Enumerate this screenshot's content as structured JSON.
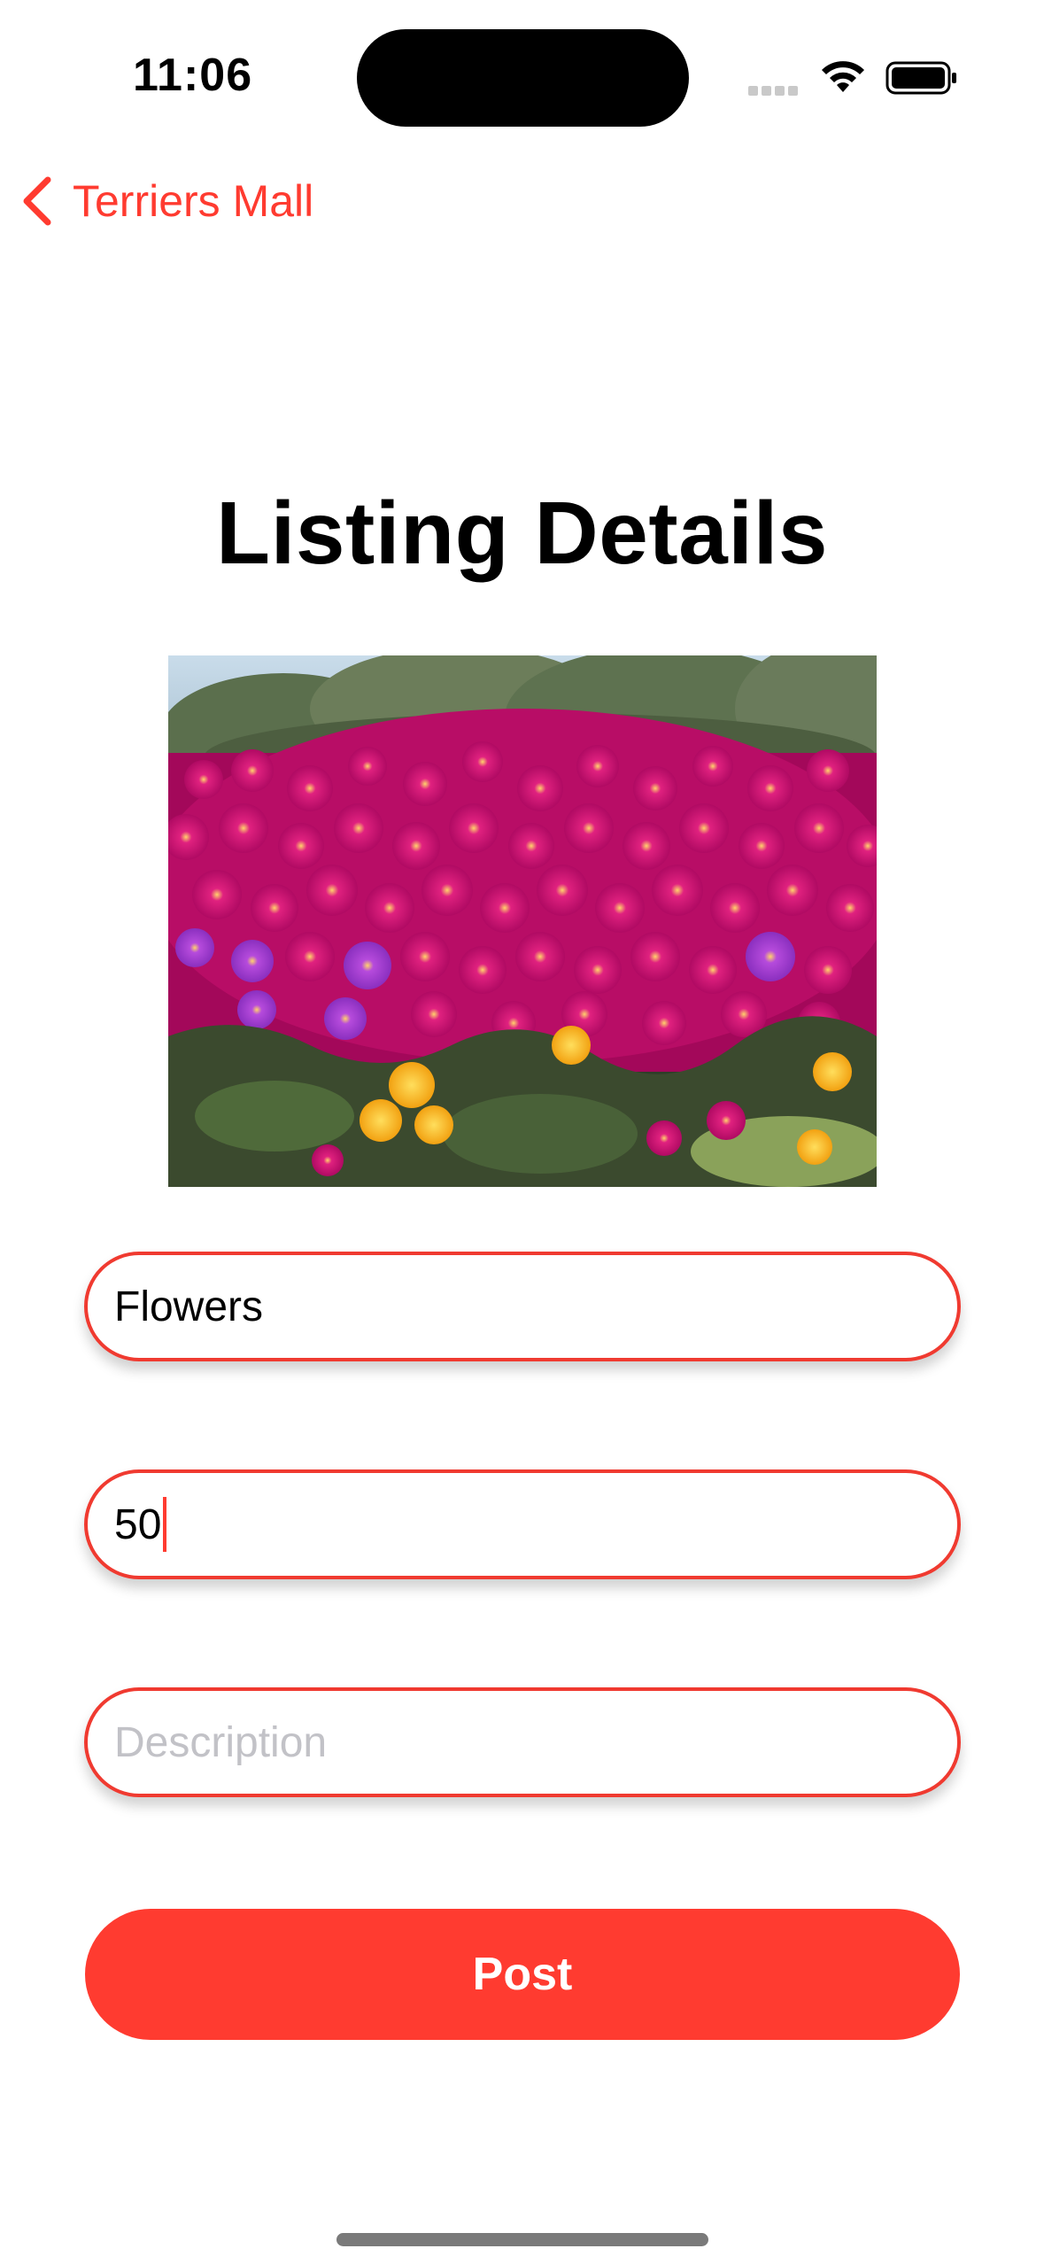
{
  "status_bar": {
    "time": "11:06"
  },
  "nav": {
    "back_label": "Terriers Mall"
  },
  "page": {
    "title": "Listing Details"
  },
  "form": {
    "name_value": "Flowers",
    "price_value": "50",
    "description_placeholder": "Description",
    "post_label": "Post"
  },
  "colors": {
    "accent": "#ff3b30",
    "field_border": "#f03a30",
    "placeholder": "#c2c2c7"
  },
  "icons": [
    "cellular-signal-icon",
    "wifi-icon",
    "battery-icon",
    "chevron-left-icon"
  ]
}
